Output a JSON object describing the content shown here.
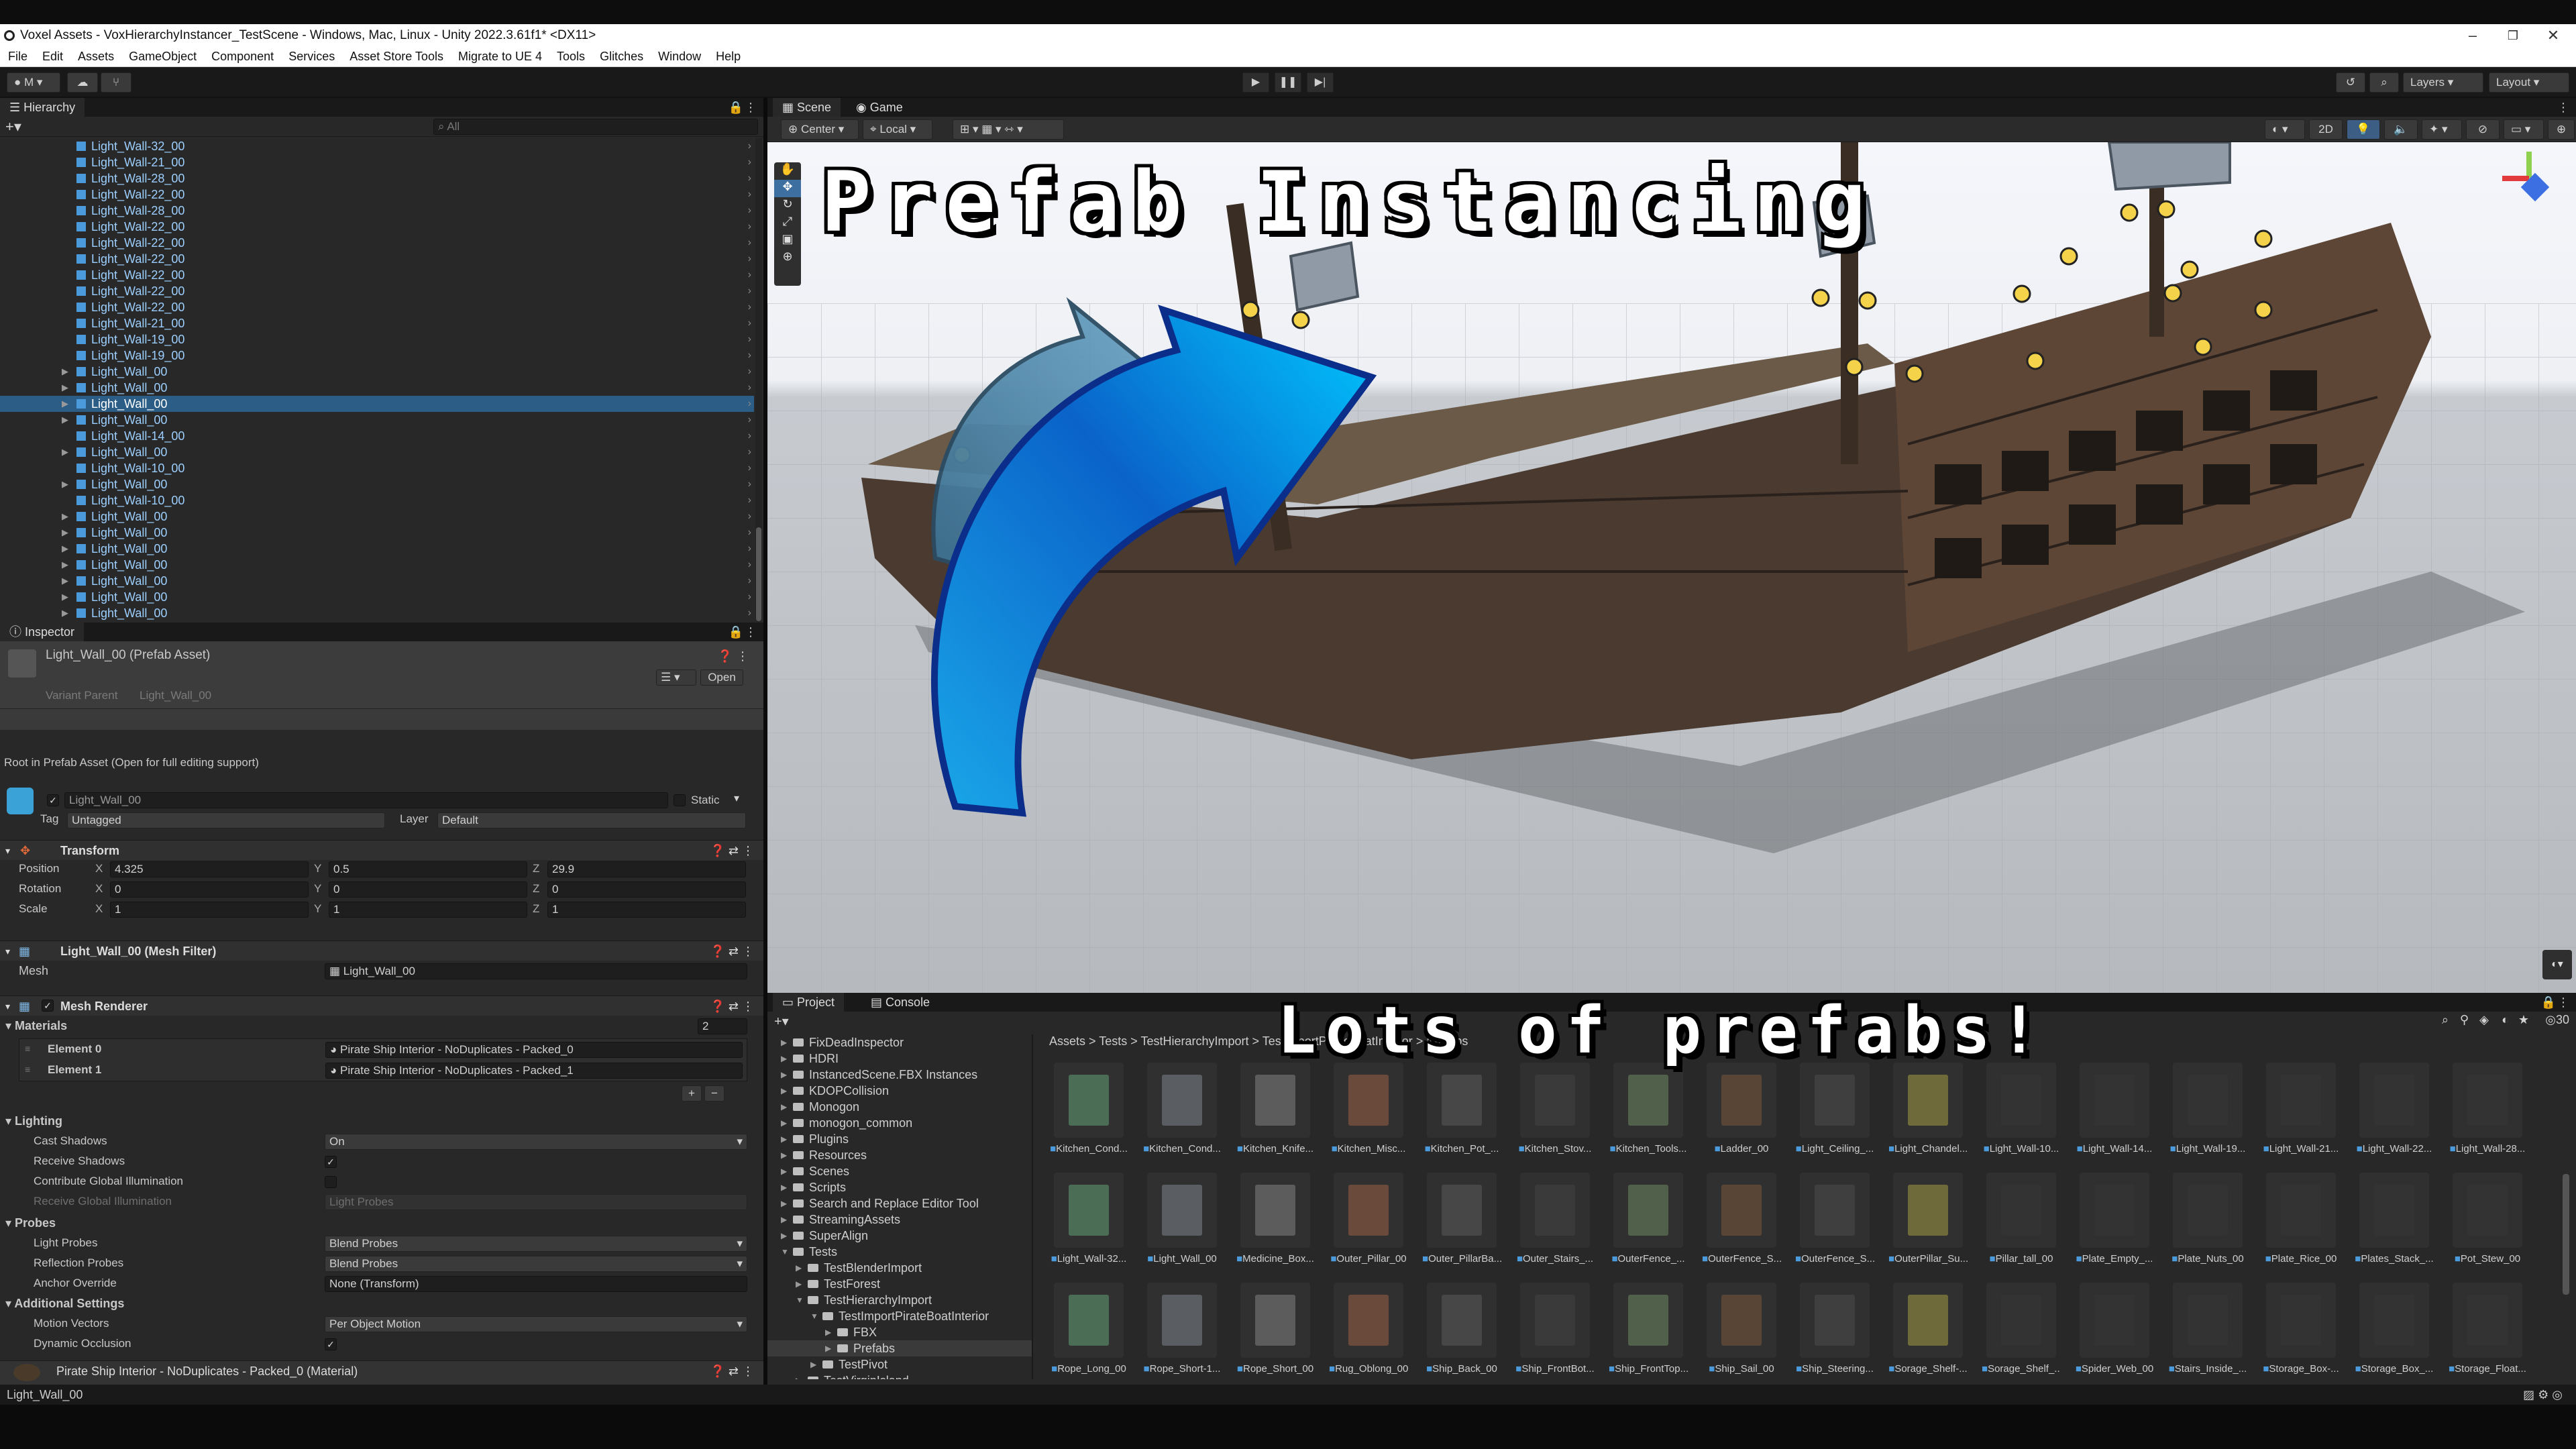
{
  "window": {
    "title": "Voxel Assets - VoxHierarchyInstancer_TestScene - Windows, Mac, Linux - Unity 2022.3.61f1* <DX11>",
    "controls": [
      "–",
      "❐",
      "✕"
    ]
  },
  "menu": [
    "File",
    "Edit",
    "Assets",
    "GameObject",
    "Component",
    "Services",
    "Asset Store Tools",
    "Migrate to UE 4",
    "Tools",
    "Glitches",
    "Window",
    "Help"
  ],
  "toolbar": {
    "account": "M",
    "layers": "Layers",
    "layout": "Layout"
  },
  "hierarchy": {
    "title": "Hierarchy",
    "search_placeholder": "All",
    "items": [
      {
        "label": "Light_Wall-32_00",
        "expand": false,
        "selected": false
      },
      {
        "label": "Light_Wall-21_00",
        "expand": false,
        "selected": false
      },
      {
        "label": "Light_Wall-28_00",
        "expand": false,
        "selected": false
      },
      {
        "label": "Light_Wall-22_00",
        "expand": false,
        "selected": false
      },
      {
        "label": "Light_Wall-28_00",
        "expand": false,
        "selected": false
      },
      {
        "label": "Light_Wall-22_00",
        "expand": false,
        "selected": false
      },
      {
        "label": "Light_Wall-22_00",
        "expand": false,
        "selected": false
      },
      {
        "label": "Light_Wall-22_00",
        "expand": false,
        "selected": false
      },
      {
        "label": "Light_Wall-22_00",
        "expand": false,
        "selected": false
      },
      {
        "label": "Light_Wall-22_00",
        "expand": false,
        "selected": false
      },
      {
        "label": "Light_Wall-22_00",
        "expand": false,
        "selected": false
      },
      {
        "label": "Light_Wall-21_00",
        "expand": false,
        "selected": false
      },
      {
        "label": "Light_Wall-19_00",
        "expand": false,
        "selected": false
      },
      {
        "label": "Light_Wall-19_00",
        "expand": false,
        "selected": false
      },
      {
        "label": "Light_Wall_00",
        "expand": true,
        "selected": false
      },
      {
        "label": "Light_Wall_00",
        "expand": true,
        "selected": false
      },
      {
        "label": "Light_Wall_00",
        "expand": true,
        "selected": true
      },
      {
        "label": "Light_Wall_00",
        "expand": true,
        "selected": false
      },
      {
        "label": "Light_Wall-14_00",
        "expand": false,
        "selected": false
      },
      {
        "label": "Light_Wall_00",
        "expand": true,
        "selected": false
      },
      {
        "label": "Light_Wall-10_00",
        "expand": false,
        "selected": false
      },
      {
        "label": "Light_Wall_00",
        "expand": true,
        "selected": false
      },
      {
        "label": "Light_Wall-10_00",
        "expand": false,
        "selected": false
      },
      {
        "label": "Light_Wall_00",
        "expand": true,
        "selected": false
      },
      {
        "label": "Light_Wall_00",
        "expand": true,
        "selected": false
      },
      {
        "label": "Light_Wall_00",
        "expand": true,
        "selected": false
      },
      {
        "label": "Light_Wall_00",
        "expand": true,
        "selected": false
      },
      {
        "label": "Light_Wall_00",
        "expand": true,
        "selected": false
      },
      {
        "label": "Light_Wall_00",
        "expand": true,
        "selected": false
      },
      {
        "label": "Light_Wall_00",
        "expand": true,
        "selected": false
      }
    ]
  },
  "inspector": {
    "title": "Inspector",
    "asset_title": "Light_Wall_00 (Prefab Asset)",
    "open_button": "Open",
    "variant_parent_label": "Variant Parent",
    "variant_parent_value": "Light_Wall_00",
    "root_note": "Root in Prefab Asset (Open for full editing support)",
    "object_name": "Light_Wall_00",
    "static_label": "Static",
    "tag_label": "Tag",
    "tag_value": "Untagged",
    "layer_label": "Layer",
    "layer_value": "Default",
    "transform": {
      "title": "Transform",
      "rows": [
        {
          "label": "Position",
          "x": "4.325",
          "y": "0.5",
          "z": "29.9"
        },
        {
          "label": "Rotation",
          "x": "0",
          "y": "0",
          "z": "0"
        },
        {
          "label": "Scale",
          "x": "1",
          "y": "1",
          "z": "1"
        }
      ]
    },
    "mesh_filter": {
      "title": "Light_Wall_00 (Mesh Filter)",
      "mesh_label": "Mesh",
      "mesh_value": "Light_Wall_00"
    },
    "mesh_renderer": {
      "title": "Mesh Renderer",
      "materials_label": "Materials",
      "materials_count": "2",
      "elements": [
        {
          "label": "Element 0",
          "value": "Pirate Ship Interior - NoDuplicates - Packed_0"
        },
        {
          "label": "Element 1",
          "value": "Pirate Ship Interior - NoDuplicates - Packed_1"
        }
      ]
    },
    "lighting": {
      "title": "Lighting",
      "cast_shadows_label": "Cast Shadows",
      "cast_shadows_value": "On",
      "receive_shadows_label": "Receive Shadows",
      "contribute_gi_label": "Contribute Global Illumination",
      "receive_gi_label": "Receive Global Illumination",
      "receive_gi_value": "Light Probes"
    },
    "probes": {
      "title": "Probes",
      "light_probes_label": "Light Probes",
      "light_probes_value": "Blend Probes",
      "reflection_probes_label": "Reflection Probes",
      "reflection_probes_value": "Blend Probes",
      "anchor_override_label": "Anchor Override",
      "anchor_override_value": "None (Transform)"
    },
    "additional": {
      "title": "Additional Settings",
      "motion_vectors_label": "Motion Vectors",
      "motion_vectors_value": "Per Object Motion",
      "dynamic_occlusion_label": "Dynamic Occlusion"
    },
    "material_footer": "Pirate Ship Interior - NoDuplicates - Packed_0 (Material)"
  },
  "scene": {
    "tabs": [
      "Scene",
      "Game"
    ],
    "pivot": "Center",
    "space": "Local",
    "mode_2d": "2D"
  },
  "overlay": {
    "title": "Prefab Instancing",
    "subtitle": "Lots of prefabs!"
  },
  "project": {
    "tabs": [
      "Project",
      "Console"
    ],
    "breadcrumb": [
      "Assets",
      "Tests",
      "TestHierarchyImport",
      "TestImportPirateBoatInterior",
      "Prefabs"
    ],
    "visible_count": "30",
    "folders": [
      {
        "label": "FixDeadInspector",
        "depth": 0,
        "open": false
      },
      {
        "label": "HDRI",
        "depth": 0,
        "open": false
      },
      {
        "label": "InstancedScene.FBX Instances",
        "depth": 0,
        "open": false
      },
      {
        "label": "KDOPCollision",
        "depth": 0,
        "open": false
      },
      {
        "label": "Monogon",
        "depth": 0,
        "open": false
      },
      {
        "label": "monogon_common",
        "depth": 0,
        "open": false
      },
      {
        "label": "Plugins",
        "depth": 0,
        "open": false
      },
      {
        "label": "Resources",
        "depth": 0,
        "open": false
      },
      {
        "label": "Scenes",
        "depth": 0,
        "open": false
      },
      {
        "label": "Scripts",
        "depth": 0,
        "open": false
      },
      {
        "label": "Search and Replace Editor Tool",
        "depth": 0,
        "open": false
      },
      {
        "label": "StreamingAssets",
        "depth": 0,
        "open": false
      },
      {
        "label": "SuperAlign",
        "depth": 0,
        "open": false
      },
      {
        "label": "Tests",
        "depth": 0,
        "open": true
      },
      {
        "label": "TestBlenderImport",
        "depth": 1,
        "open": false
      },
      {
        "label": "TestForest",
        "depth": 1,
        "open": false
      },
      {
        "label": "TestHierarchyImport",
        "depth": 1,
        "open": true
      },
      {
        "label": "TestImportPirateBoatInterior",
        "depth": 2,
        "open": true
      },
      {
        "label": "FBX",
        "depth": 3,
        "open": false
      },
      {
        "label": "Prefabs",
        "depth": 3,
        "open": false,
        "selected": true
      },
      {
        "label": "TestPivot",
        "depth": 2,
        "open": false
      },
      {
        "label": "TestVirginIsland",
        "depth": 1,
        "open": false
      }
    ],
    "assets": [
      "Kitchen_Cond...",
      "Kitchen_Cond...",
      "Kitchen_Knife...",
      "Kitchen_Misc...",
      "Kitchen_Pot_...",
      "Kitchen_Stov...",
      "Kitchen_Tools...",
      "Ladder_00",
      "Light_Ceiling_...",
      "Light_Chandel...",
      "Light_Wall-10...",
      "Light_Wall-14...",
      "Light_Wall-19...",
      "Light_Wall-21...",
      "Light_Wall-22...",
      "Light_Wall-28...",
      "Light_Wall-32...",
      "Light_Wall_00",
      "Medicine_Box...",
      "Outer_Pillar_00",
      "Outer_PillarBa...",
      "Outer_Stairs_...",
      "OuterFence_...",
      "OuterFence_S...",
      "OuterFence_S...",
      "OuterPillar_Su...",
      "Pillar_tall_00",
      "Plate_Empty_...",
      "Plate_Nuts_00",
      "Plate_Rice_00",
      "Plates_Stack_...",
      "Pot_Stew_00",
      "Rope_Long_00",
      "Rope_Short-1...",
      "Rope_Short_00",
      "Rug_Oblong_00",
      "Ship_Back_00",
      "Ship_FrontBot...",
      "Ship_FrontTop...",
      "Ship_Sail_00",
      "Ship_Steering...",
      "Sorage_Shelf-...",
      "Sorage_Shelf_...",
      "Spider_Web_00",
      "Stairs_Inside_...",
      "Storage_Box-...",
      "Storage_Box_...",
      "Storage_Float..."
    ]
  },
  "status": {
    "selected": "Light_Wall_00"
  }
}
